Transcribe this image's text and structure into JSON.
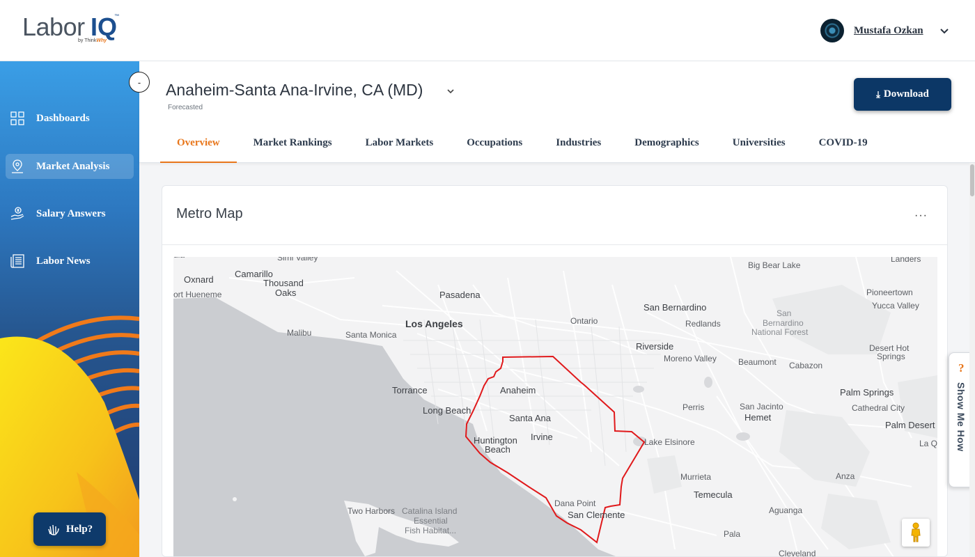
{
  "brand": {
    "name_part1": "Labor",
    "name_part2": "IQ",
    "byline_prefix": "by Think",
    "byline_brand": "Why"
  },
  "user": {
    "name": "Mustafa Ozkan",
    "avatar_icon": "avatar-icon"
  },
  "sidebar": {
    "collapse_label": "-",
    "items": [
      {
        "label": "Dashboards",
        "icon": "grid-icon",
        "active": false
      },
      {
        "label": "Market Analysis",
        "icon": "location-pin-icon",
        "active": true
      },
      {
        "label": "Salary Answers",
        "icon": "hand-dollar-icon",
        "active": false
      },
      {
        "label": "Labor News",
        "icon": "newspaper-icon",
        "active": false
      }
    ],
    "help_label": "Help?"
  },
  "header": {
    "market": "Anaheim-Santa Ana-Irvine, CA (MD)",
    "subtitle": "Forecasted",
    "download_label": "Download"
  },
  "tabs": [
    {
      "label": "Overview",
      "active": true
    },
    {
      "label": "Market Rankings",
      "active": false
    },
    {
      "label": "Labor Markets",
      "active": false
    },
    {
      "label": "Occupations",
      "active": false
    },
    {
      "label": "Industries",
      "active": false
    },
    {
      "label": "Demographics",
      "active": false
    },
    {
      "label": "Universities",
      "active": false
    },
    {
      "label": "COVID-19",
      "active": false
    }
  ],
  "card": {
    "title": "Metro Map",
    "menu_label": "···"
  },
  "map": {
    "places": {
      "simi_valley": "Simi Valley",
      "oxnard": "Oxnard",
      "camarillo": "Camarillo",
      "port_hueneme": "ort Hueneme",
      "thousand_oaks_1": "Thousand",
      "thousand_oaks_2": "Oaks",
      "pasadena": "Pasadena",
      "los_angeles": "Los Angeles",
      "malibu": "Malibu",
      "santa_monica": "Santa Monica",
      "ontario": "Ontario",
      "san_bernardino": "San Bernardino",
      "redlands": "Redlands",
      "sbnf_1": "San",
      "sbnf_2": "Bernardino",
      "sbnf_3": "National Forest",
      "big_bear_lake": "Big Bear Lake",
      "landers": "Landers",
      "pioneertown": "Pioneertown",
      "yucca_valley": "Yucca Valley",
      "riverside": "Riverside",
      "moreno_valley": "Moreno Valley",
      "beaumont": "Beaumont",
      "cabazon": "Cabazon",
      "desert_hot_springs_1": "Desert Hot",
      "desert_hot_springs_2": "Springs",
      "palm_springs": "Palm Springs",
      "cathedral_city": "Cathedral City",
      "palm_desert": "Palm Desert",
      "la_quinta": "La Quint",
      "torrance": "Torrance",
      "long_beach": "Long Beach",
      "anaheim": "Anaheim",
      "santa_ana": "Santa Ana",
      "huntington_beach_1": "Huntington",
      "huntington_beach_2": "Beach",
      "irvine": "Irvine",
      "perris": "Perris",
      "san_jacinto": "San Jacinto",
      "hemet": "Hemet",
      "lake_elsinore": "Lake Elsinore",
      "murrieta": "Murrieta",
      "temecula": "Temecula",
      "anza": "Anza",
      "aguanga": "Aguanga",
      "dana_point": "Dana Point",
      "san_clemente": "San Clemente",
      "two_harbors": "Two Harbors",
      "catalina_1": "Catalina Island",
      "catalina_2": "Essential",
      "catalina_3": "Fish Habitat...",
      "pala": "Pala",
      "cleveland": "Cleveland",
      "top_left_partial": "ula"
    },
    "region_color": "#e0191b",
    "pegman_icon": "pegman-icon"
  },
  "show_me_how": {
    "icon": "question-icon",
    "label": "Show Me How"
  },
  "colors": {
    "accent": "#e8761b",
    "navy": "#0c3766",
    "sidebar_top": "#3a9ee6",
    "sidebar_bottom": "#203a6e"
  }
}
